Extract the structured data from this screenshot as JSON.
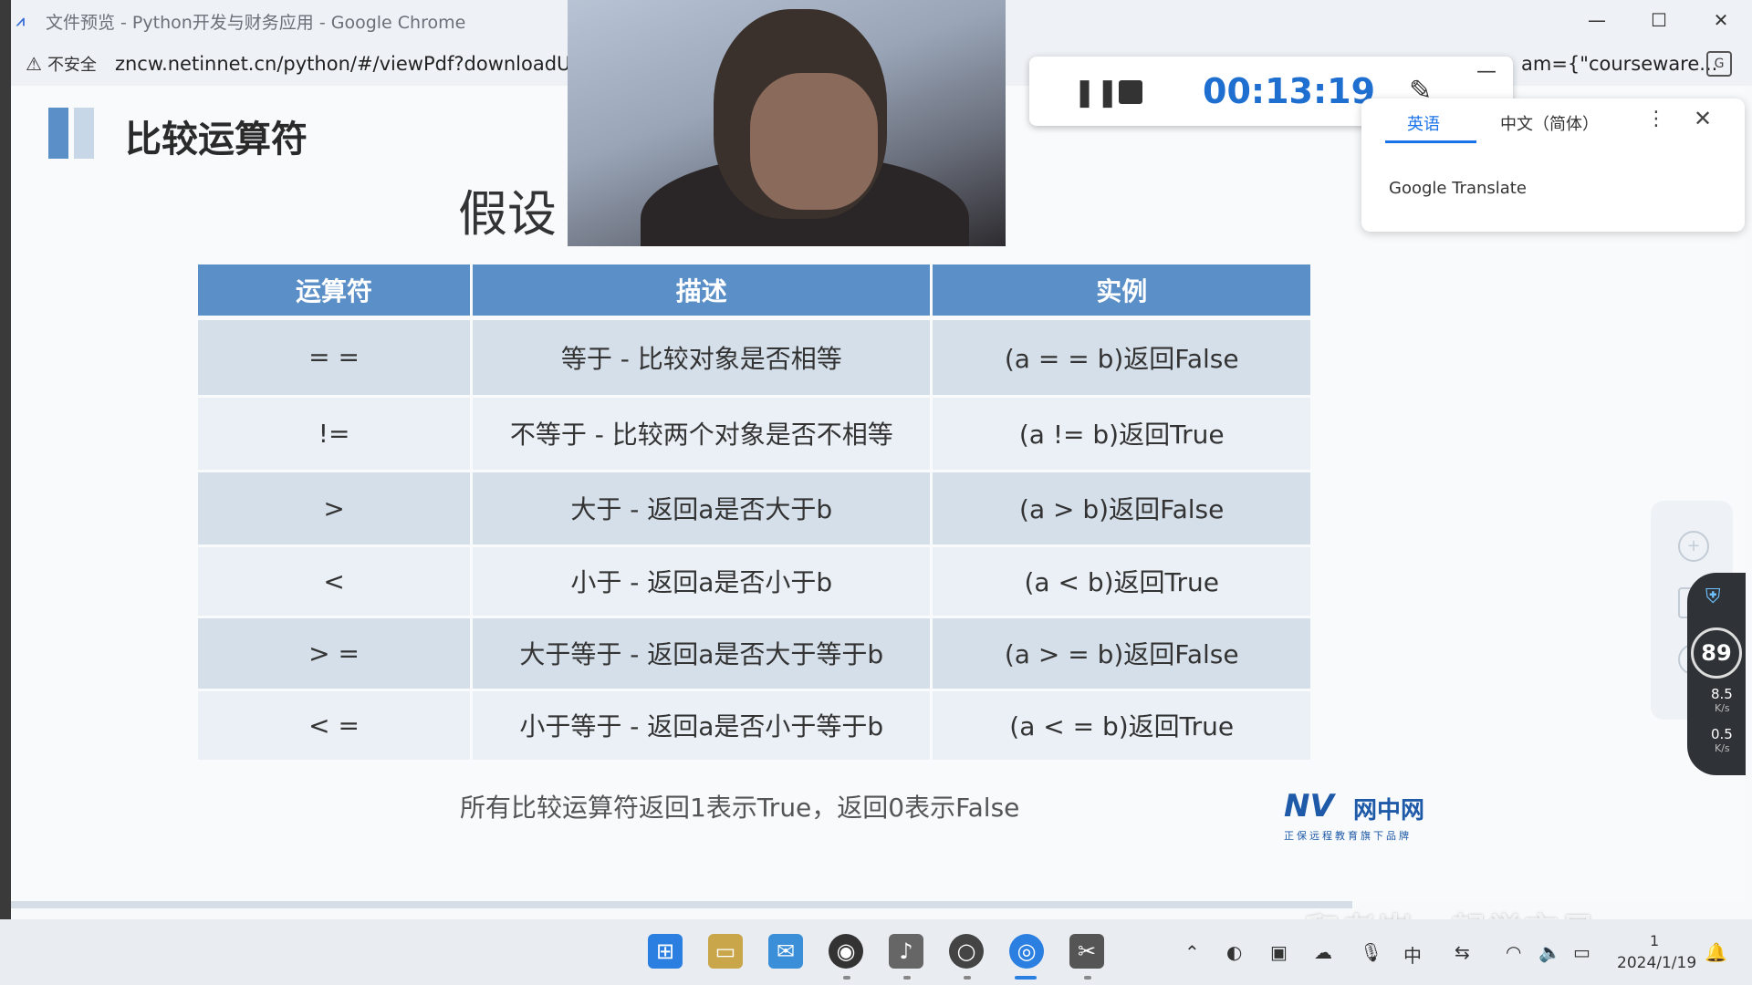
{
  "browser": {
    "window_title": "文件预览 - Python开发与财务应用 - Google Chrome",
    "security_label": "不安全",
    "url": "zncw.netinnet.cn/python/#/viewPdf?downloadUr",
    "url_tail": "am={\"courseware..."
  },
  "slide": {
    "heading": "比较运算符",
    "subheading": "假设",
    "table": {
      "headers": [
        "运算符",
        "描述",
        "实例"
      ],
      "rows": [
        [
          "= =",
          "等于 - 比较对象是否相等",
          "(a  = =  b)返回False"
        ],
        [
          "!=",
          "不等于 - 比较两个对象是否不相等",
          "(a  !=  b)返回True"
        ],
        [
          ">",
          "大于 - 返回a是否大于b",
          "(a  >  b)返回False"
        ],
        [
          "<",
          "小于 - 返回a是否小于b",
          "(a  <  b)返回True"
        ],
        [
          "> =",
          "大于等于 - 返回a是否大于等于b",
          "(a  > =  b)返回False"
        ],
        [
          "< =",
          "小于等于 - 返回a是否小于等于b",
          "(a  < =  b)返回True"
        ]
      ]
    },
    "footnote": "所有比较运算符返回1表示True，返回0表示False",
    "logo": {
      "mark": "NV",
      "name": "网中网",
      "tagline": "正保远程教育旗下品牌"
    }
  },
  "recorder": {
    "timer": "00:13:19"
  },
  "translate_popup": {
    "tab_source": "英语",
    "tab_target": "中文（简体）",
    "brand": "Google Translate"
  },
  "net_monitor": {
    "percent": "89",
    "upload": "8.5",
    "upload_unit": "K/s",
    "download": "0.5",
    "download_unit": "K/s"
  },
  "taskbar": {
    "ime": "中",
    "time": "1",
    "date": "2024/1/19"
  },
  "watermark": "和老崔一起学交易",
  "colors": {
    "header_blue": "#5b8fc7",
    "row_dark": "#d5dfea",
    "row_light": "#eaf0f6",
    "timer_blue": "#1f6fd1"
  }
}
